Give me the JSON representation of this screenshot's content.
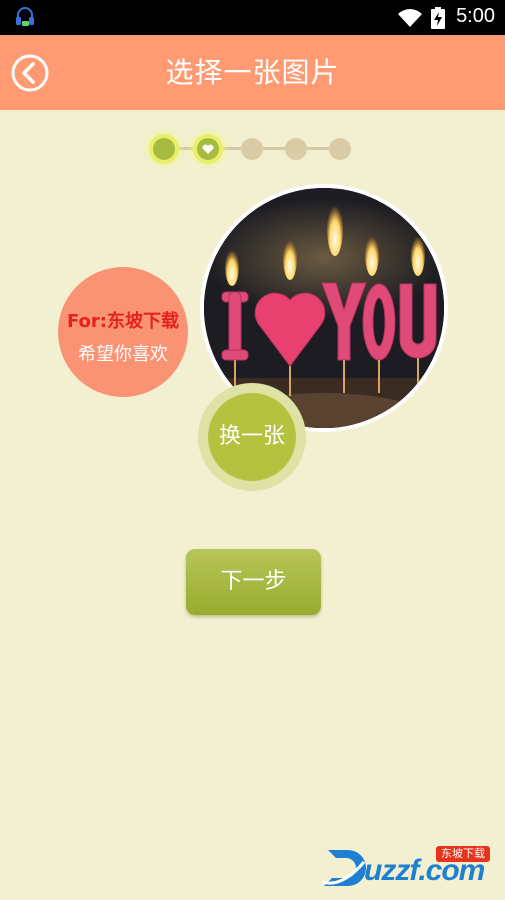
{
  "status_bar": {
    "time": "5:00",
    "icons": [
      "headset-icon",
      "wifi-icon",
      "battery-charging-icon"
    ]
  },
  "header": {
    "title": "选择一张图片",
    "back_icon": "back-arrow-icon",
    "background": "#ff9a73"
  },
  "progress": {
    "total_steps": 5,
    "current_step": 2,
    "active_color": "#a8bb41",
    "inactive_color": "#dacba7"
  },
  "photo": {
    "description_icon": "photo-i-love-you-candles"
  },
  "dedication": {
    "line1": "For:东坡下载",
    "line2": "希望你喜欢"
  },
  "change_button": {
    "label": "换一张"
  },
  "next_button": {
    "label": "下一步"
  },
  "watermark": {
    "text": "uzzf.com",
    "badge": "东坡下载"
  }
}
